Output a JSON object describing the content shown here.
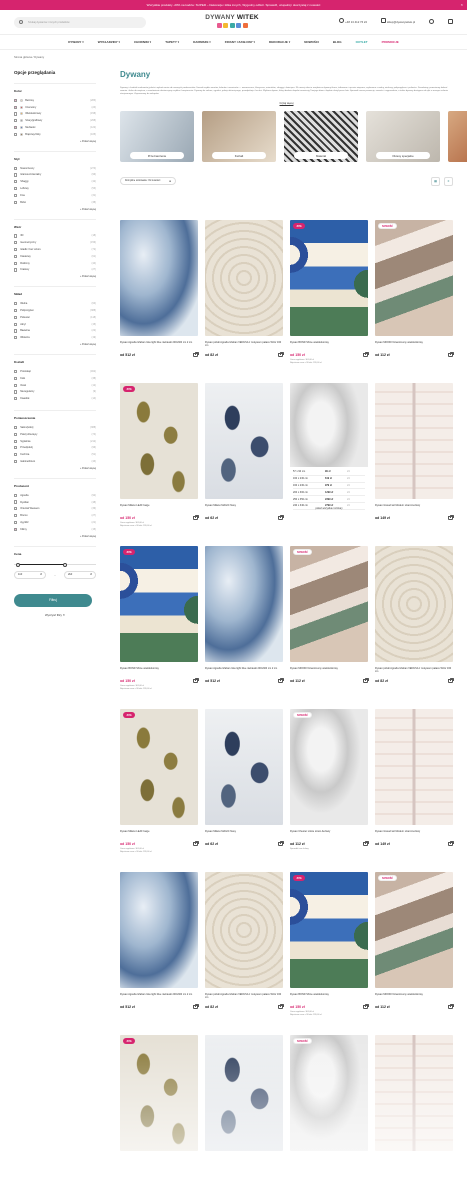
{
  "topbar": {
    "text": "Wszystkie produkty -20% na kodzie: SUPER – Dekoracje i kilka innych, Wygodny odbiór. Sprawdź, uzupełnij i skorzystaj z nowości",
    "close": "×"
  },
  "header": {
    "search_placeholder": "Szukaj dywanów i innych produktów",
    "logo_text_a": "DYWANY",
    "logo_text_b": "WITEK",
    "logo_colors": [
      "#e85a8f",
      "#f4b731",
      "#3aa9a5",
      "#5b8ed8",
      "#ef6e3d"
    ],
    "phone": "+48 13 412 76 22",
    "email": "sklep@dywanywitek.pl"
  },
  "nav": [
    "DYWANY",
    "WYKŁADZINY",
    "CHODNIKI",
    "TAPETY",
    "KARNISZE",
    "FIRANY I ZASŁONY",
    "DEKORACJE",
    "NOWOŚCI",
    "BLOG",
    "OUTLET",
    "PROMOCJE"
  ],
  "breadcrumb": "Strona główna / Dywany",
  "sidebar": {
    "title": "Opcje przeglądania",
    "groups": [
      {
        "title": "Kolor",
        "options": [
          {
            "label": "Beżowy",
            "count": "(283)",
            "swatch": "#e9dcc2",
            "checked": true
          },
          {
            "label": "Czerwony",
            "count": "(24)",
            "swatch": "#d33c3c",
            "checked": true
          },
          {
            "label": "Wielokolorowy",
            "count": "(158)",
            "swatch": "#f3b04a"
          },
          {
            "label": "Szary/grafitowy",
            "count": "(268)",
            "swatch": "#9a9a9a"
          },
          {
            "label": "Niebieski",
            "count": "(122)",
            "swatch": "#4a6fb5",
            "checked": true
          },
          {
            "label": "Brązowy/złoty",
            "count": "(105)",
            "swatch": "#8d6a3c"
          }
        ],
        "more": "+ Pokaż więcej"
      },
      {
        "title": "Styl",
        "options": [
          {
            "label": "Nowoczesny",
            "count": "(274)"
          },
          {
            "label": "Glamour/orientalny",
            "count": "(96)"
          },
          {
            "label": "Shaggy",
            "count": "(42)"
          },
          {
            "label": "Loftowy",
            "count": "(53)"
          },
          {
            "label": "Fine",
            "count": "(31)"
          },
          {
            "label": "Boho",
            "count": "(38)"
          }
        ],
        "more": "+ Pokaż więcej"
      },
      {
        "title": "Wzór",
        "options": [
          {
            "label": "3D",
            "count": "(18)"
          },
          {
            "label": "Geometryczny",
            "count": "(156)"
          },
          {
            "label": "Gładki / bez wzoru",
            "count": "(72)"
          },
          {
            "label": "Kwiatowy",
            "count": "(61)"
          },
          {
            "label": "Roślinny",
            "count": "(44)"
          },
          {
            "label": "Kratowy",
            "count": "(27)"
          }
        ],
        "more": "+ Pokaż więcej"
      },
      {
        "title": "Skład",
        "options": [
          {
            "label": "Wełna",
            "count": "(64)"
          },
          {
            "label": "Polipropylen",
            "count": "(388)"
          },
          {
            "label": "Poliester",
            "count": "(118)"
          },
          {
            "label": "Akryl",
            "count": "(15)"
          },
          {
            "label": "Bawełna",
            "count": "(22)"
          },
          {
            "label": "Wiskoza",
            "count": "(19)"
          }
        ],
        "more": "+ Pokaż więcej"
      },
      {
        "title": "Kształt",
        "options": [
          {
            "label": "Prostokąt",
            "count": "(462)"
          },
          {
            "label": "Koło",
            "count": "(38)"
          },
          {
            "label": "Owal",
            "count": "(12)"
          },
          {
            "label": "Nieregularny",
            "count": "(9)"
          },
          {
            "label": "Kwadrat",
            "count": "(14)"
          }
        ]
      },
      {
        "title": "Pomieszczenie",
        "options": [
          {
            "label": "Salon/pokój",
            "count": "(388)"
          },
          {
            "label": "Pokój dziecięcy",
            "count": "(74)"
          },
          {
            "label": "Sypialnia",
            "count": "(212)"
          },
          {
            "label": "Przedpokój",
            "count": "(96)"
          },
          {
            "label": "Kuchnia",
            "count": "(51)"
          },
          {
            "label": "Gabinet/biuro",
            "count": "(43)"
          }
        ],
        "more": "+ Pokaż więcej"
      },
      {
        "title": "Producent",
        "options": [
          {
            "label": "Agnella",
            "count": "(92)"
          },
          {
            "label": "Dywilan",
            "count": "(48)"
          },
          {
            "label": "Oriental Weavers",
            "count": "(36)"
          },
          {
            "label": "Brumo",
            "count": "(27)"
          },
          {
            "label": "Ayyildiz",
            "count": "(21)"
          },
          {
            "label": "Kilimy",
            "count": "(15)",
            "checked": true
          }
        ],
        "more": "+ Pokaż więcej"
      }
    ],
    "price": {
      "title": "Cena",
      "min": "110",
      "max": "2k0",
      "currency": "zł",
      "low": 0.05,
      "high": 0.62
    },
    "filter_btn": "Filtruj",
    "clear_btn": "Wyczyść filtry ✕"
  },
  "main": {
    "title": "Dywany",
    "description": "Dywany i chodniki znakomitej jakości wykończenia od uznanych producentów. Szeroki wybór wzorów, kolorów i rozmiarów — nowoczesne, klasyczne, orientalne, shaggy i dziecięce. W naszej ofercie znajdziesz dywany tkane, tuftowane i ręcznie wiązane, wykonane z wełny, wiskozy, polipropylenu i poliestru. Doradzimy, pomożemy dobrać rozmiar i kolor do wnętrza, a zamówienie dostarczymy szybko i bezpiecznie. Dywany do salonu, sypialni, pokoju dziecięcego, przedpokoju i kuchni. Wybierz dywan, który idealnie dopełni aranżację Twojego domu i będzie służył przez lata. Sprawdź nasze promocje, nowości i wyprzedaże, a także dywany dostępne od ręki w naszym salonie stacjonarnym. Zapraszamy do zakupów.",
    "read_more": "Czytaj więcej",
    "categories": [
      "Przeznaczenie",
      "Kształt",
      "Materiał",
      "Okresy specjalne"
    ],
    "sort_label": "Domyślne sortowanie: Od nowości",
    "filter_icon": "☰",
    "view_grid": "▦",
    "view_list": "≡"
  },
  "size_popup": {
    "rows": [
      {
        "size": "57 x 90 cm",
        "price": "99 zł",
        "stock": "24"
      },
      {
        "size": "160 x 230 cm",
        "price": "619 zł",
        "stock": "24"
      },
      {
        "size": "160 x 230 cm",
        "price": "979 zł",
        "stock": "24"
      },
      {
        "size": "200 x 300 cm",
        "price": "1299 zł",
        "stock": "24"
      },
      {
        "size": "250 x 350 cm",
        "price": "2399 zł",
        "stock": "24"
      },
      {
        "size": "240 x 340 cm",
        "price": "2799 zł",
        "stock": "24"
      }
    ],
    "more": "pokaż wszystkie rozmiary"
  },
  "products": [
    {
      "pattern": "p-blue",
      "name": "Dywan Agnella Isfahan Icke light blue niebieski 200x300 cm 2 cm",
      "price": "od 512 zł"
    },
    {
      "pattern": "p-damask",
      "name": "Dywan polski Agnella Isfahan VENUSA z motywem pałacu Wzór 160 cm",
      "price": "od 82 zł"
    },
    {
      "pattern": "p-wave",
      "badge": "-50%",
      "badge_type": "sale",
      "name": "Dywan BOND Shine wielokolorowy",
      "price": "od 150 zł",
      "red": true,
      "sub": "Cena regularna: 301,00 zł\nNajniższa cena z 30 dni: 226,00 zł"
    },
    {
      "pattern": "p-stripe",
      "badge": "NOWOŚĆ",
      "badge_type": "new",
      "name": "Dywan MOODI Nowoczesny wielokolorowy",
      "price": "od 112 zł"
    },
    {
      "pattern": "p-leaf",
      "badge": "-50%",
      "badge_type": "sale",
      "name": "Dywan Milano LEAF beige",
      "price": "od 150 zł",
      "red": true,
      "sub": "Cena regularna: 301,00 zł\nNajniższa cena z 30 dni: 226,00 zł"
    },
    {
      "pattern": "p-blueleaf",
      "name": "Dywan Milano MAGIC Navy",
      "price": "od 62 zł"
    },
    {
      "pattern": "p-grey",
      "popup": true,
      "name": "",
      "price": ""
    },
    {
      "pattern": "p-geo",
      "name": "Dywan Gravell art Modern szaro-beżowy",
      "price": "od 149 zł"
    },
    {
      "pattern": "p-wave",
      "badge": "-50%",
      "badge_type": "sale",
      "name": "Dywan BOND Shine wielokolorowy",
      "price": "od 150 zł",
      "red": true,
      "sub": "Cena regularna: 301,00 zł\nNajniższa cena z 30 dni: 226,00 zł"
    },
    {
      "pattern": "p-blue",
      "name": "Dywan Agnella Isfahan Icke light blue niebieski 200x300 cm 2 cm",
      "price": "od 512 zł"
    },
    {
      "pattern": "p-stripe",
      "badge": "NOWOŚĆ",
      "badge_type": "new",
      "name": "Dywan MOODI Nowoczesny wielokolorowy",
      "price": "od 112 zł"
    },
    {
      "pattern": "p-damask",
      "name": "Dywan polski Agnella Isfahan VENUSA z motywem pałacu Wzór 160 cm",
      "price": "od 82 zł"
    },
    {
      "pattern": "p-leaf",
      "badge": "-50%",
      "badge_type": "sale",
      "name": "Dywan Milano LEAF beige",
      "price": "od 150 zł",
      "red": true,
      "sub": "Cena regularna: 301,00 zł\nNajniższa cena z 30 dni: 226,00 zł"
    },
    {
      "pattern": "p-blueleaf",
      "name": "Dywan Milano MAGIC Navy",
      "price": "od 62 zł"
    },
    {
      "pattern": "p-grey",
      "badge": "NOWOŚĆ",
      "badge_type": "new",
      "name": "Dywan Chester Liście szaro-beżowy",
      "price": "od 112 zł",
      "sub": "Sprawdź inne kolory"
    },
    {
      "pattern": "p-geo",
      "name": "Dywan Gravell art Modern szaro-beżowy",
      "price": "od 149 zł"
    },
    {
      "pattern": "p-blue",
      "name": "Dywan Agnella Isfahan Icke light blue niebieski 200x300 cm 2 cm",
      "price": "od 512 zł"
    },
    {
      "pattern": "p-damask",
      "name": "Dywan polski Agnella Isfahan VENUSA z motywem pałacu Wzór 160 cm",
      "price": "od 82 zł"
    },
    {
      "pattern": "p-wave",
      "badge": "-50%",
      "badge_type": "sale",
      "name": "Dywan BOND Shine wielokolorowy",
      "price": "od 150 zł",
      "red": true,
      "sub": "Cena regularna: 301,00 zł\nNajniższa cena z 30 dni: 226,00 zł"
    },
    {
      "pattern": "p-stripe",
      "badge": "NOWOŚĆ",
      "badge_type": "new",
      "name": "Dywan MOODI Nowoczesny wielokolorowy",
      "price": "od 112 zł"
    },
    {
      "pattern": "p-leaf",
      "badge": "-50%",
      "badge_type": "sale",
      "name": "",
      "price": ""
    },
    {
      "pattern": "p-blueleaf",
      "name": "",
      "price": ""
    },
    {
      "pattern": "p-grey",
      "badge": "NOWOŚĆ",
      "badge_type": "new",
      "name": "",
      "price": ""
    },
    {
      "pattern": "p-geo",
      "name": "",
      "price": ""
    }
  ]
}
